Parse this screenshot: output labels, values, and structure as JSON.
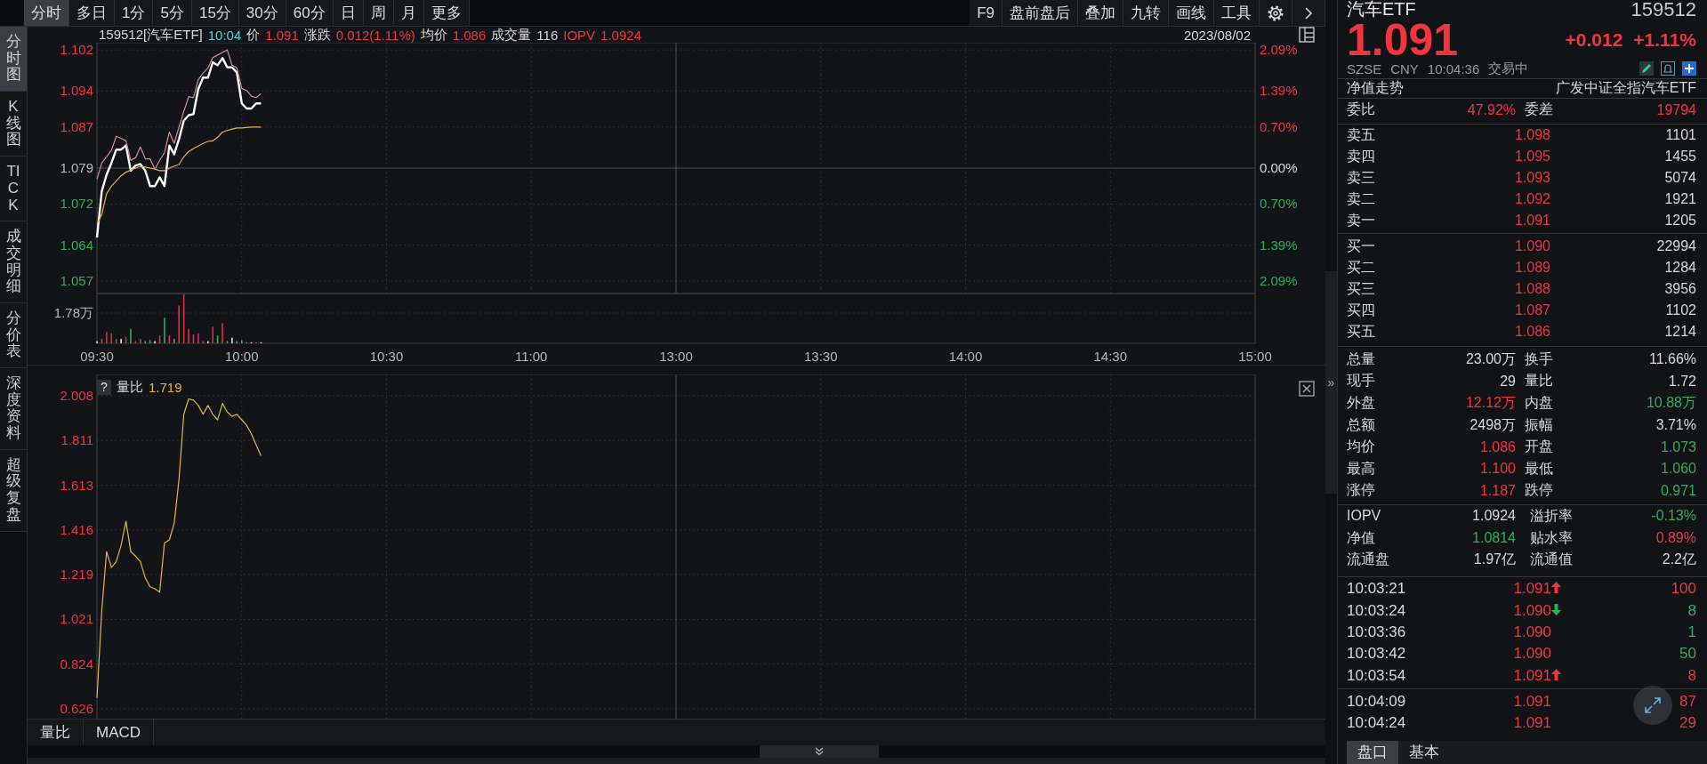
{
  "toolbar": {
    "periods": [
      {
        "label": "分时",
        "selected": true
      },
      {
        "label": "多日",
        "selected": false
      },
      {
        "label": "1分",
        "selected": false
      },
      {
        "label": "5分",
        "selected": false
      },
      {
        "label": "15分",
        "selected": false
      },
      {
        "label": "30分",
        "selected": false
      },
      {
        "label": "60分",
        "selected": false
      },
      {
        "label": "日",
        "selected": false
      },
      {
        "label": "周",
        "selected": false
      },
      {
        "label": "月",
        "selected": false
      },
      {
        "label": "更多",
        "selected": false
      }
    ],
    "tools": [
      {
        "label": "F9"
      },
      {
        "label": "盘前盘后"
      },
      {
        "label": "叠加"
      },
      {
        "label": "九转"
      },
      {
        "label": "画线"
      },
      {
        "label": "工具"
      }
    ]
  },
  "sidebar": {
    "items": [
      {
        "label": "分时图",
        "selected": true
      },
      {
        "label": "K线图",
        "selected": false
      },
      {
        "label": "TICK",
        "selected": false
      },
      {
        "label": "成交明细",
        "selected": false
      },
      {
        "label": "分价表",
        "selected": false
      },
      {
        "label": "深度资料",
        "selected": false
      },
      {
        "label": "超级复盘",
        "selected": false
      }
    ]
  },
  "price_chart": {
    "header": {
      "symbol": "159512[汽车ETF]",
      "time": "10:04",
      "fields": [
        {
          "label": {
            "text": "价",
            "color": "#d8d8d8"
          },
          "value": {
            "text": "1.091",
            "color": "#f0353f"
          }
        },
        {
          "label": {
            "text": "涨跌",
            "color": "#d8d8d8"
          },
          "value": {
            "text": "0.012(1.11%)",
            "color": "#f0353f"
          }
        },
        {
          "label": {
            "text": "均价",
            "color": "#d8d8d8"
          },
          "value": {
            "text": "1.086",
            "color": "#f0353f"
          }
        },
        {
          "label": {
            "text": "成交量",
            "color": "#d8d8d8"
          },
          "value": {
            "text": "116",
            "color": "#d8d8d8"
          }
        },
        {
          "label": {
            "text": "IOPV",
            "color": "#f0353f"
          },
          "value": {
            "text": "1.0924",
            "color": "#f0353f"
          }
        }
      ],
      "date": "2023/08/02"
    },
    "chart_data": {
      "type": "line",
      "categories": [
        "09:30",
        null,
        null,
        null,
        null,
        null,
        null,
        null,
        null,
        null,
        null,
        null,
        null,
        null,
        null,
        null,
        null,
        null,
        null,
        null,
        null,
        null,
        null,
        null,
        null,
        null,
        null,
        null,
        null,
        null,
        "10:00",
        null,
        null,
        null,
        null,
        null,
        null,
        null,
        null,
        null,
        null,
        null,
        null,
        null,
        null,
        null,
        null,
        null,
        null,
        null,
        null,
        null,
        null,
        null,
        null,
        null,
        null,
        null,
        null,
        null,
        "10:30",
        null,
        null,
        null,
        null,
        null,
        null,
        null,
        null,
        null,
        null,
        null,
        null,
        null,
        null,
        null,
        null,
        null,
        null,
        null,
        null,
        null,
        null,
        null,
        null,
        null,
        null,
        null,
        null,
        null,
        "11:00",
        null,
        null,
        null,
        null,
        null,
        null,
        null,
        null,
        null,
        null,
        null,
        null,
        null,
        null,
        null,
        null,
        null,
        null,
        null,
        null,
        null,
        null,
        null,
        null,
        null,
        null,
        null,
        null,
        null,
        "13:00",
        null,
        null,
        null,
        null,
        null,
        null,
        null,
        null,
        null,
        null,
        null,
        null,
        null,
        null,
        null,
        null,
        null,
        null,
        null,
        null,
        null,
        null,
        null,
        null,
        null,
        null,
        null,
        null,
        null,
        "13:30",
        null,
        null,
        null,
        null,
        null,
        null,
        null,
        null,
        null,
        null,
        null,
        null,
        null,
        null,
        null,
        null,
        null,
        null,
        null,
        null,
        null,
        null,
        null,
        null,
        null,
        null,
        null,
        null,
        null,
        "14:00",
        null,
        null,
        null,
        null,
        null,
        null,
        null,
        null,
        null,
        null,
        null,
        null,
        null,
        null,
        null,
        null,
        null,
        null,
        null,
        null,
        null,
        null,
        null,
        null,
        null,
        null,
        null,
        null,
        null,
        "14:30",
        null,
        null,
        null,
        null,
        null,
        null,
        null,
        null,
        null,
        null,
        null,
        null,
        null,
        null,
        null,
        null,
        null,
        null,
        null,
        null,
        null,
        null,
        null,
        null,
        null,
        null,
        null,
        null,
        null,
        "15:00"
      ],
      "grid": true,
      "ylim": [
        1.0546,
        1.1034
      ],
      "yticks": [
        {
          "value": 1.102,
          "label": "1.102"
        },
        {
          "value": 1.094,
          "label": "1.094"
        },
        {
          "value": 1.087,
          "label": "1.087"
        },
        {
          "value": 1.079,
          "label": "1.079"
        },
        {
          "value": 1.072,
          "label": "1.072"
        },
        {
          "value": 1.064,
          "label": "1.064"
        },
        {
          "value": 1.057,
          "label": "1.057"
        }
      ],
      "series": [
        {
          "color": "#ffffff",
          "values": [
            1.0655,
            1.0745,
            1.0777,
            1.08,
            1.0826,
            1.0826,
            1.0834,
            1.0785,
            1.0795,
            1.0798,
            1.0785,
            1.0755,
            1.0755,
            1.0772,
            1.0755,
            1.0834,
            1.0817,
            1.0846,
            1.0882,
            1.0893,
            1.0895,
            1.0944,
            1.0966,
            1.0966,
            1.0996,
            1.099,
            1.1004,
            1.0986,
            1.0986,
            1.0976,
            1.0916,
            1.0906,
            1.0906,
            1.0916,
            1.0916,
            null,
            null,
            null,
            null,
            null,
            null,
            null,
            null,
            null,
            null,
            null,
            null,
            null,
            null,
            null,
            null,
            null,
            null,
            null,
            null,
            null,
            null,
            null,
            null,
            null,
            null,
            null,
            null,
            null,
            null,
            null,
            null,
            null,
            null,
            null,
            null,
            null,
            null,
            null,
            null,
            null,
            null,
            null,
            null,
            null,
            null,
            null,
            null,
            null,
            null,
            null,
            null,
            null,
            null,
            null,
            null,
            null,
            null,
            null,
            null,
            null,
            null,
            null,
            null,
            null,
            null,
            null,
            null,
            null,
            null,
            null,
            null,
            null,
            null,
            null,
            null,
            null,
            null,
            null,
            null,
            null,
            null,
            null,
            null,
            null,
            null,
            null,
            null,
            null,
            null,
            null,
            null,
            null,
            null,
            null,
            null,
            null,
            null,
            null,
            null,
            null,
            null,
            null,
            null,
            null,
            null,
            null,
            null,
            null,
            null,
            null,
            null,
            null,
            null,
            null,
            null,
            null,
            null,
            null,
            null,
            null,
            null,
            null,
            null,
            null,
            null,
            null,
            null,
            null,
            null,
            null,
            null,
            null,
            null,
            null,
            null,
            null,
            null,
            null,
            null,
            null,
            null,
            null,
            null,
            null,
            null,
            null,
            null,
            null,
            null,
            null,
            null,
            null,
            null,
            null,
            null,
            null,
            null,
            null,
            null,
            null,
            null,
            null,
            null,
            null,
            null,
            null,
            null,
            null,
            null,
            null,
            null,
            null,
            null,
            null,
            null,
            null,
            null,
            null,
            null,
            null,
            null,
            null,
            null,
            null,
            null,
            null,
            null,
            null,
            null,
            null,
            null,
            null,
            null,
            null,
            null,
            null,
            null,
            null,
            null,
            null,
            null,
            null,
            null,
            null,
            null
          ]
        },
        {
          "color": "#e8b53c",
          "values": [
            1.068,
            1.07,
            1.074,
            1.0755,
            1.0765,
            1.0775,
            1.0782,
            1.0786,
            1.079,
            1.0793,
            1.0792,
            1.079,
            1.0788,
            1.0785,
            1.0785,
            1.079,
            1.0794,
            1.0797,
            1.0812,
            1.0822,
            1.0828,
            1.0833,
            1.0838,
            1.0842,
            1.0843,
            1.085,
            1.086,
            1.0863,
            1.0866,
            1.0868,
            1.0868,
            1.0869,
            1.087,
            1.087,
            1.087,
            null,
            null,
            null,
            null,
            null,
            null,
            null,
            null,
            null,
            null,
            null,
            null,
            null,
            null,
            null,
            null,
            null,
            null,
            null,
            null,
            null,
            null,
            null,
            null,
            null,
            null,
            null,
            null,
            null,
            null,
            null,
            null,
            null,
            null,
            null,
            null,
            null,
            null,
            null,
            null,
            null,
            null,
            null,
            null,
            null,
            null,
            null,
            null,
            null,
            null,
            null,
            null,
            null,
            null,
            null,
            null,
            null,
            null,
            null,
            null,
            null,
            null,
            null,
            null,
            null,
            null,
            null,
            null,
            null,
            null,
            null,
            null,
            null,
            null,
            null,
            null,
            null,
            null,
            null,
            null,
            null,
            null,
            null,
            null,
            null,
            null,
            null,
            null,
            null,
            null,
            null,
            null,
            null,
            null,
            null,
            null,
            null,
            null,
            null,
            null,
            null,
            null,
            null,
            null,
            null,
            null,
            null,
            null,
            null,
            null,
            null,
            null,
            null,
            null,
            null,
            null,
            null,
            null,
            null,
            null,
            null,
            null,
            null,
            null,
            null,
            null,
            null,
            null,
            null,
            null,
            null,
            null,
            null,
            null,
            null,
            null,
            null,
            null,
            null,
            null,
            null,
            null,
            null,
            null,
            null,
            null,
            null,
            null,
            null,
            null,
            null,
            null,
            null,
            null,
            null,
            null,
            null,
            null,
            null,
            null,
            null,
            null,
            null,
            null,
            null,
            null,
            null,
            null,
            null,
            null,
            null,
            null,
            null,
            null,
            null,
            null,
            null,
            null,
            null,
            null,
            null,
            null,
            null,
            null,
            null,
            null,
            null,
            null,
            null,
            null,
            null,
            null,
            null,
            null,
            null,
            null,
            null,
            null,
            null,
            null,
            null,
            null,
            null,
            null,
            null,
            null
          ]
        },
        {
          "color": "#d98a96",
          "values": [
            1.0768,
            1.08,
            1.0812,
            1.0825,
            1.0852,
            1.0848,
            1.0843,
            1.0805,
            1.081,
            1.0831,
            1.0808,
            1.0808,
            1.0788,
            1.0805,
            1.082,
            1.086,
            1.0838,
            1.087,
            1.09,
            1.0929,
            1.0927,
            1.0962,
            1.0975,
            1.0985,
            1.1005,
            1.101,
            1.1015,
            1.102,
            1.099,
            1.0985,
            1.0945,
            1.0941,
            1.093,
            1.0927,
            1.0935,
            null,
            null,
            null,
            null,
            null,
            null,
            null,
            null,
            null,
            null,
            null,
            null,
            null,
            null,
            null,
            null,
            null,
            null,
            null,
            null,
            null,
            null,
            null,
            null,
            null,
            null,
            null,
            null,
            null,
            null,
            null,
            null,
            null,
            null,
            null,
            null,
            null,
            null,
            null,
            null,
            null,
            null,
            null,
            null,
            null,
            null,
            null,
            null,
            null,
            null,
            null,
            null,
            null,
            null,
            null,
            null,
            null,
            null,
            null,
            null,
            null,
            null,
            null,
            null,
            null,
            null,
            null,
            null,
            null,
            null,
            null,
            null,
            null,
            null,
            null,
            null,
            null,
            null,
            null,
            null,
            null,
            null,
            null,
            null,
            null,
            null,
            null,
            null,
            null,
            null,
            null,
            null,
            null,
            null,
            null,
            null,
            null,
            null,
            null,
            null,
            null,
            null,
            null,
            null,
            null,
            null,
            null,
            null,
            null,
            null,
            null,
            null,
            null,
            null,
            null,
            null,
            null,
            null,
            null,
            null,
            null,
            null,
            null,
            null,
            null,
            null,
            null,
            null,
            null,
            null,
            null,
            null,
            null,
            null,
            null,
            null,
            null,
            null,
            null,
            null,
            null,
            null,
            null,
            null,
            null,
            null,
            null,
            null,
            null,
            null,
            null,
            null,
            null,
            null,
            null,
            null,
            null,
            null,
            null,
            null,
            null,
            null,
            null,
            null,
            null,
            null,
            null,
            null,
            null,
            null,
            null,
            null,
            null,
            null,
            null,
            null,
            null,
            null,
            null,
            null,
            null,
            null,
            null,
            null,
            null,
            null,
            null,
            null,
            null,
            null,
            null,
            null,
            null,
            null,
            null,
            null,
            null,
            null,
            null,
            null,
            null,
            null,
            null,
            null,
            null,
            null
          ]
        }
      ]
    },
    "percent_labels": [
      {
        "text": "2.09%",
        "color": "#f0353f"
      },
      {
        "text": "1.39%",
        "color": "#f0353f"
      },
      {
        "text": "0.70%",
        "color": "#f0353f"
      },
      {
        "text": "0.00%",
        "color": "#d8d8d8"
      },
      {
        "text": "0.70%",
        "color": "#2fb056"
      },
      {
        "text": "1.39%",
        "color": "#2fb056"
      },
      {
        "text": "2.09%",
        "color": "#2fb056"
      }
    ],
    "volume_label": "1.78万"
  },
  "ratio_chart": {
    "help": "?",
    "label": "量比",
    "value": "1.719",
    "chart_data": {
      "type": "line",
      "grid": true,
      "categories": [
        null,
        null,
        null,
        null,
        null,
        null,
        null,
        null,
        null,
        null,
        null,
        null,
        null,
        null,
        null,
        null,
        null,
        null,
        null,
        null,
        null,
        null,
        null,
        null,
        null,
        null,
        null,
        null,
        null,
        null,
        null,
        null,
        null,
        null,
        null,
        null,
        null,
        null,
        null,
        null,
        null,
        null,
        null,
        null,
        null,
        null,
        null,
        null,
        null,
        null,
        null,
        null,
        null,
        null,
        null,
        null,
        null,
        null,
        null,
        null,
        null,
        null,
        null,
        null,
        null,
        null,
        null,
        null,
        null,
        null,
        null,
        null,
        null,
        null,
        null,
        null,
        null,
        null,
        null,
        null,
        null,
        null,
        null,
        null,
        null,
        null,
        null,
        null,
        null,
        null,
        null,
        null,
        null,
        null,
        null,
        null,
        null,
        null,
        null,
        null,
        null,
        null,
        null,
        null,
        null,
        null,
        null,
        null,
        null,
        null,
        null,
        null,
        null,
        null,
        null,
        null,
        null,
        null,
        null,
        null,
        null,
        null,
        null,
        null,
        null,
        null,
        null,
        null,
        null,
        null,
        null,
        null,
        null,
        null,
        null,
        null,
        null,
        null,
        null,
        null,
        null,
        null,
        null,
        null,
        null,
        null,
        null,
        null,
        null,
        null,
        null,
        null,
        null,
        null,
        null,
        null,
        null,
        null,
        null,
        null,
        null,
        null,
        null,
        null,
        null,
        null,
        null,
        null,
        null,
        null,
        null,
        null,
        null,
        null,
        null,
        null,
        null,
        null,
        null,
        null,
        null,
        null,
        null,
        null,
        null,
        null,
        null,
        null,
        null,
        null,
        null,
        null,
        null,
        null,
        null,
        null,
        null,
        null,
        null,
        null,
        null,
        null,
        null,
        null,
        null,
        null,
        null,
        null,
        null,
        null,
        null,
        null,
        null,
        null,
        null,
        null,
        null,
        null,
        null,
        null,
        null,
        null,
        null,
        null,
        null,
        null,
        null,
        null,
        null,
        null,
        null,
        null,
        null,
        null,
        null,
        null,
        null,
        null,
        null,
        null,
        null
      ],
      "ylim": [
        0.579,
        2.102
      ],
      "yticks": [
        {
          "value": 2.008,
          "label": "2.008"
        },
        {
          "value": 1.811,
          "label": "1.811"
        },
        {
          "value": 1.613,
          "label": "1.613"
        },
        {
          "value": 1.416,
          "label": "1.416"
        },
        {
          "value": 1.219,
          "label": "1.219"
        },
        {
          "value": 1.021,
          "label": "1.021"
        },
        {
          "value": 0.824,
          "label": "0.824"
        },
        {
          "value": 0.626,
          "label": "0.626"
        }
      ],
      "series": [
        {
          "color": "#e8b53c",
          "values": [
            0.674,
            1.06,
            1.32,
            1.25,
            1.276,
            1.348,
            1.454,
            1.32,
            1.3,
            1.276,
            1.204,
            1.165,
            1.156,
            1.141,
            1.358,
            1.372,
            1.445,
            1.637,
            1.926,
            1.994,
            1.989,
            1.965,
            1.926,
            1.965,
            1.926,
            1.902,
            1.974,
            1.936,
            1.917,
            1.926,
            1.902,
            1.878,
            1.84,
            1.791,
            1.743,
            null,
            null,
            null,
            null,
            null,
            null,
            null,
            null,
            null,
            null,
            null,
            null,
            null,
            null,
            null,
            null,
            null,
            null,
            null,
            null,
            null,
            null,
            null,
            null,
            null,
            null,
            null,
            null,
            null,
            null,
            null,
            null,
            null,
            null,
            null,
            null,
            null,
            null,
            null,
            null,
            null,
            null,
            null,
            null,
            null,
            null,
            null,
            null,
            null,
            null,
            null,
            null,
            null,
            null,
            null,
            null,
            null,
            null,
            null,
            null,
            null,
            null,
            null,
            null,
            null,
            null,
            null,
            null,
            null,
            null,
            null,
            null,
            null,
            null,
            null,
            null,
            null,
            null,
            null,
            null,
            null,
            null,
            null,
            null,
            null,
            null,
            null,
            null,
            null,
            null,
            null,
            null,
            null,
            null,
            null,
            null,
            null,
            null,
            null,
            null,
            null,
            null,
            null,
            null,
            null,
            null,
            null,
            null,
            null,
            null,
            null,
            null,
            null,
            null,
            null,
            null,
            null,
            null,
            null,
            null,
            null,
            null,
            null,
            null,
            null,
            null,
            null,
            null,
            null,
            null,
            null,
            null,
            null,
            null,
            null,
            null,
            null,
            null,
            null,
            null,
            null,
            null,
            null,
            null,
            null,
            null,
            null,
            null,
            null,
            null,
            null,
            null,
            null,
            null,
            null,
            null,
            null,
            null,
            null,
            null,
            null,
            null,
            null,
            null,
            null,
            null,
            null,
            null,
            null,
            null,
            null,
            null,
            null,
            null,
            null,
            null,
            null,
            null,
            null,
            null,
            null,
            null,
            null,
            null,
            null,
            null,
            null,
            null,
            null,
            null,
            null,
            null,
            null,
            null,
            null,
            null,
            null,
            null,
            null,
            null,
            null,
            null,
            null,
            null,
            null,
            null
          ]
        }
      ]
    }
  },
  "indicator_tabs": [
    {
      "label": "量比"
    },
    {
      "label": "MACD"
    }
  ],
  "side_handle": "»",
  "quote": {
    "name": "汽车ETF",
    "code": "159512",
    "price": "1.091",
    "color": "#f0353f",
    "change": "+0.012",
    "change_pct": "+1.11%",
    "meta": [
      "SZSE",
      "CNY",
      "10:04:36",
      "交易中"
    ],
    "nav_link": "净值走势",
    "full_name": "广发中证全指汽车ETF",
    "order_ratio": [
      {
        "label": "委比",
        "value": {
          "text": "47.92%",
          "color": "#f0353f"
        }
      },
      {
        "label": "委差",
        "value": {
          "text": "19794",
          "color": "#f0353f"
        }
      }
    ],
    "asks": [
      {
        "label": "卖五",
        "price": {
          "text": "1.098",
          "color": "#f0353f"
        },
        "volume": "1101"
      },
      {
        "label": "卖四",
        "price": {
          "text": "1.095",
          "color": "#f0353f"
        },
        "volume": "1455"
      },
      {
        "label": "卖三",
        "price": {
          "text": "1.093",
          "color": "#f0353f"
        },
        "volume": "5074"
      },
      {
        "label": "卖二",
        "price": {
          "text": "1.092",
          "color": "#f0353f"
        },
        "volume": "1921"
      },
      {
        "label": "卖一",
        "price": {
          "text": "1.091",
          "color": "#f0353f"
        },
        "volume": "1205"
      }
    ],
    "bids": [
      {
        "label": "买一",
        "price": {
          "text": "1.090",
          "color": "#f0353f"
        },
        "volume": "22994"
      },
      {
        "label": "买二",
        "price": {
          "text": "1.089",
          "color": "#f0353f"
        },
        "volume": "1284"
      },
      {
        "label": "买三",
        "price": {
          "text": "1.088",
          "color": "#f0353f"
        },
        "volume": "3956"
      },
      {
        "label": "买四",
        "price": {
          "text": "1.087",
          "color": "#f0353f"
        },
        "volume": "1102"
      },
      {
        "label": "买五",
        "price": {
          "text": "1.086",
          "color": "#f0353f"
        },
        "volume": "1214"
      }
    ],
    "stats": [
      [
        {
          "label": "总量",
          "value": {
            "text": "23.00万",
            "color": "#d8d8d8"
          }
        },
        {
          "label": "换手",
          "value": {
            "text": "11.66%",
            "color": "#d8d8d8"
          }
        }
      ],
      [
        {
          "label": "现手",
          "value": {
            "text": "29",
            "color": "#d8d8d8"
          }
        },
        {
          "label": "量比",
          "value": {
            "text": "1.72",
            "color": "#d8d8d8"
          }
        }
      ],
      [
        {
          "label": "外盘",
          "value": {
            "text": "12.12万",
            "color": "#f0353f"
          }
        },
        {
          "label": "内盘",
          "value": {
            "text": "10.88万",
            "color": "#2fb056"
          }
        }
      ],
      [
        {
          "label": "总额",
          "value": {
            "text": "2498万",
            "color": "#d8d8d8"
          }
        },
        {
          "label": "振幅",
          "value": {
            "text": "3.71%",
            "color": "#d8d8d8"
          }
        }
      ],
      [
        {
          "label": "均价",
          "value": {
            "text": "1.086",
            "color": "#f0353f"
          }
        },
        {
          "label": "开盘",
          "value": {
            "text": "1.073",
            "color": "#2fb056"
          }
        }
      ],
      [
        {
          "label": "最高",
          "value": {
            "text": "1.100",
            "color": "#f0353f"
          }
        },
        {
          "label": "最低",
          "value": {
            "text": "1.060",
            "color": "#2fb056"
          }
        }
      ],
      [
        {
          "label": "涨停",
          "value": {
            "text": "1.187",
            "color": "#f0353f"
          }
        },
        {
          "label": "跌停",
          "value": {
            "text": "0.971",
            "color": "#2fb056"
          }
        }
      ]
    ],
    "fund_stats": [
      [
        {
          "label": "IOPV",
          "value": {
            "text": "1.0924",
            "color": "#d8d8d8"
          }
        },
        {
          "label": "溢折率",
          "value": {
            "text": "-0.13%",
            "color": "#2fb056"
          }
        }
      ],
      [
        {
          "label": "净值",
          "value": {
            "text": "1.0814",
            "color": "#2fb056"
          }
        },
        {
          "label": "贴水率",
          "value": {
            "text": "0.89%",
            "color": "#f0353f"
          }
        }
      ],
      [
        {
          "label": "流通盘",
          "value": {
            "text": "1.97亿",
            "color": "#d8d8d8"
          }
        },
        {
          "label": "流通值",
          "value": {
            "text": "2.2亿",
            "color": "#d8d8d8"
          }
        }
      ]
    ],
    "trades": [
      {
        "time": "10:03:21",
        "price": {
          "text": "1.091",
          "color": "#f0353f"
        },
        "arrow_up": true,
        "arrow_down": false,
        "volume": {
          "text": "100",
          "color": "#f0353f"
        }
      },
      {
        "time": "10:03:24",
        "price": {
          "text": "1.090",
          "color": "#f0353f"
        },
        "arrow_up": false,
        "arrow_down": true,
        "volume": {
          "text": "8",
          "color": "#2fb056"
        }
      },
      {
        "time": "10:03:36",
        "price": {
          "text": "1.090",
          "color": "#f0353f"
        },
        "arrow_up": false,
        "arrow_down": false,
        "volume": {
          "text": "1",
          "color": "#2fb056"
        }
      },
      {
        "time": "10:03:42",
        "price": {
          "text": "1.090",
          "color": "#f0353f"
        },
        "arrow_up": false,
        "arrow_down": false,
        "volume": {
          "text": "50",
          "color": "#2fb056"
        }
      },
      {
        "time": "10:03:54",
        "price": {
          "text": "1.091",
          "color": "#f0353f"
        },
        "arrow_up": true,
        "arrow_down": false,
        "volume": {
          "text": "8",
          "color": "#f0353f"
        }
      }
    ],
    "recent_trades": [
      {
        "time": "10:04:09",
        "price": {
          "text": "1.091",
          "color": "#f0353f"
        },
        "arrow_up": false,
        "arrow_down": false,
        "volume": {
          "text": "87",
          "color": "#f0353f"
        }
      },
      {
        "time": "10:04:24",
        "price": {
          "text": "1.091",
          "color": "#f0353f"
        },
        "arrow_up": false,
        "arrow_down": false,
        "volume": {
          "text": "29",
          "color": "#f0353f"
        }
      }
    ],
    "tabs": [
      {
        "label": "盘口",
        "selected": true
      },
      {
        "label": "基本",
        "selected": false
      }
    ]
  }
}
